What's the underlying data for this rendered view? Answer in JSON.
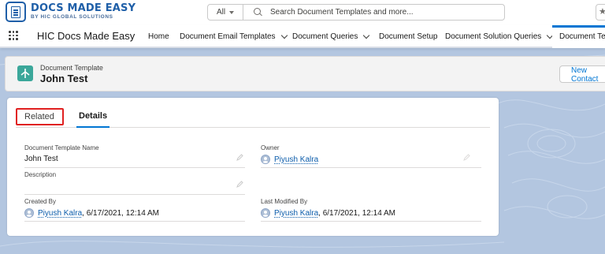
{
  "header": {
    "logo_title": "DOCS MADE EASY",
    "logo_subtitle": "BY HIC GLOBAL SOLUTIONS",
    "search_scope": "All",
    "search_placeholder": "Search Document Templates and more...",
    "favorites_icon": "star-icon"
  },
  "nav": {
    "app_name": "HIC Docs Made Easy",
    "items": [
      {
        "label": "Home",
        "has_menu": false
      },
      {
        "label": "Document Email Templates",
        "has_menu": true
      },
      {
        "label": "Document Queries",
        "has_menu": true
      },
      {
        "label": "Document Setup",
        "has_menu": false
      },
      {
        "label": "Document Solution Queries",
        "has_menu": true
      }
    ],
    "active_tab": "Document Tem"
  },
  "record": {
    "object_type": "Document Template",
    "name": "John Test",
    "new_contact_label": "New Contact",
    "icon_color": "#3ba79a"
  },
  "tabs": {
    "related": "Related",
    "details": "Details"
  },
  "fields": {
    "template_name_label": "Document Template Name",
    "template_name_value": "John Test",
    "owner_label": "Owner",
    "owner_value": "Piyush Kalra",
    "description_label": "Description",
    "description_value": "",
    "created_by_label": "Created By",
    "created_by_user": "Piyush Kalra",
    "created_by_date": ", 6/17/2021, 12:14 AM",
    "modified_by_label": "Last Modified By",
    "modified_by_user": "Piyush Kalra",
    "modified_by_date": ", 6/17/2021, 12:14 AM"
  }
}
